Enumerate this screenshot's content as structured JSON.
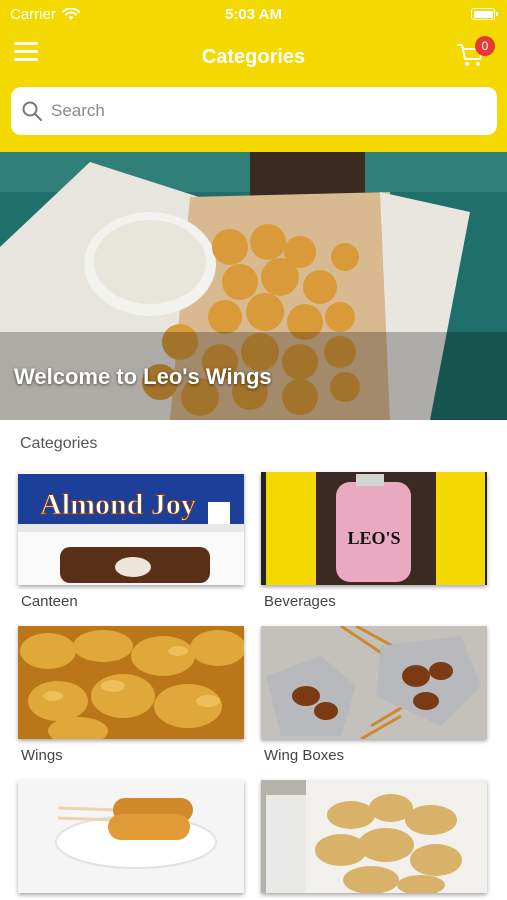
{
  "status_bar": {
    "carrier": "Carrier",
    "time": "5:03 AM"
  },
  "nav": {
    "title": "Categories",
    "cart_count": "0"
  },
  "search": {
    "placeholder": "Search"
  },
  "hero": {
    "caption": "Welcome to Leo's Wings"
  },
  "section": {
    "title": "Categories"
  },
  "categories": [
    {
      "label": "Canteen",
      "brand_text": "Almond Joy"
    },
    {
      "label": "Beverages",
      "brand_text": "LEO'S"
    },
    {
      "label": "Wings"
    },
    {
      "label": "Wing Boxes"
    },
    {
      "label": ""
    },
    {
      "label": ""
    }
  ],
  "colors": {
    "header": "#f4d900",
    "badge": "#e53935",
    "hero_tray": "#1f6f6a"
  }
}
